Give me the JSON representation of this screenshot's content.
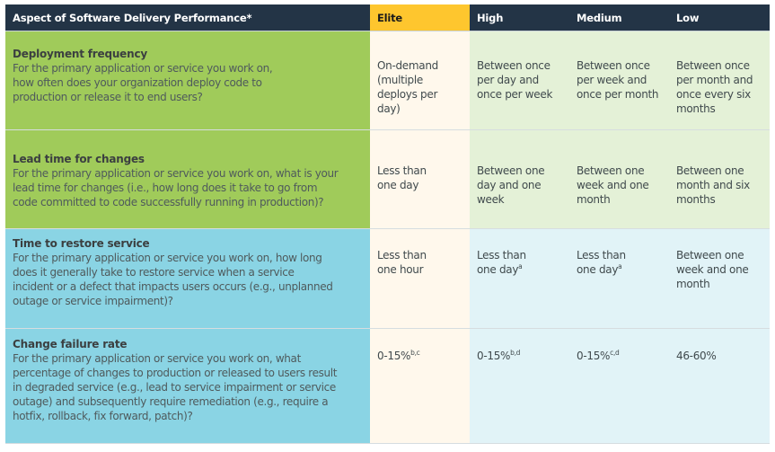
{
  "header": {
    "aspect": "Aspect of Software Delivery Performance*",
    "elite": "Elite",
    "high": "High",
    "medium": "Medium",
    "low": "Low"
  },
  "colors": {
    "header_bg": "#233446",
    "elite_header_bg": "#fec62e",
    "throughput_aspect_bg": "#a0cb5a",
    "stability_aspect_bg": "#8ad4e4",
    "elite_cell_bg": "#fff8ec",
    "throughput_cell_bg": "#e4f1d7",
    "stability_cell_bg": "#e1f3f7"
  },
  "rows": [
    {
      "title": "Deployment frequency",
      "description": "For the primary application or service you work on, how often does your organization deploy code to production or release it to end users?",
      "elite": {
        "text": "On-demand (multiple deploys per day)",
        "sup": ""
      },
      "high": {
        "text": "Between once per day and once per week",
        "sup": ""
      },
      "medium": {
        "text": "Between once per week and once per month",
        "sup": ""
      },
      "low": {
        "text": "Between once per month and once every six months",
        "sup": ""
      }
    },
    {
      "title": "Lead time for changes",
      "description": "For the primary application or service you work on, what is your lead time for changes (i.e., how long does it take to go from code committed to code successfully running in production)?",
      "elite": {
        "text": "Less than one day",
        "sup": ""
      },
      "high": {
        "text": "Between one day and one week",
        "sup": ""
      },
      "medium": {
        "text": "Between one week and one month",
        "sup": ""
      },
      "low": {
        "text": "Between one month and six months",
        "sup": ""
      }
    },
    {
      "title": "Time to restore service",
      "description": "For the primary application or service you work on, how long does it generally take to restore service when a service incident or a defect that impacts users occurs (e.g., unplanned outage or service impairment)?",
      "elite": {
        "text": "Less than one hour",
        "sup": ""
      },
      "high": {
        "text": "Less than one day",
        "sup": "a"
      },
      "medium": {
        "text": "Less than one day",
        "sup": "a"
      },
      "low": {
        "text": "Between one week and one month",
        "sup": ""
      }
    },
    {
      "title": "Change failure rate",
      "description": "For the primary application or service you work on, what percentage of changes to production or released to users result in degraded service (e.g., lead to service impairment or service outage) and subsequently require remediation (e.g., require a hotfix, rollback, fix forward, patch)?",
      "elite": {
        "text": "0-15%",
        "sup": "b,c"
      },
      "high": {
        "text": "0-15%",
        "sup": "b,d"
      },
      "medium": {
        "text": "0-15%",
        "sup": "c,d"
      },
      "low": {
        "text": "46-60%",
        "sup": ""
      }
    }
  ]
}
